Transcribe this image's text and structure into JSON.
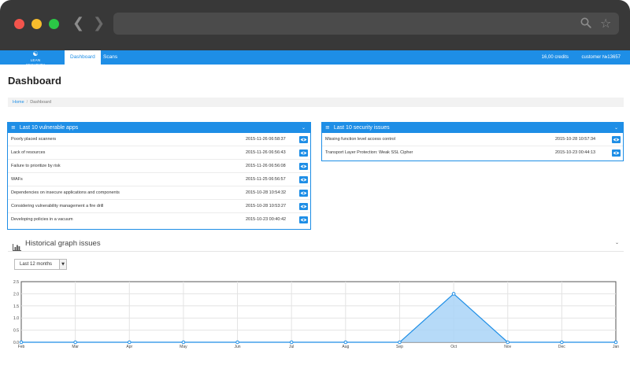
{
  "app": {
    "logo_text": "LEAN SECURITY",
    "tabs": [
      {
        "label": "Dashboard",
        "active": true
      },
      {
        "label": "Scans",
        "active": false
      }
    ],
    "credits": "16,00 credits",
    "customer": "customer №13657"
  },
  "page": {
    "title": "Dashboard",
    "breadcrumb": {
      "home": "Home",
      "separator": "/",
      "current": "Dashboard"
    }
  },
  "vulnerable_apps": {
    "title": "Last 10 vulnerable apps",
    "rows": [
      {
        "name": "Poorly placed scanners",
        "date": "2015-11-26 06:58:37"
      },
      {
        "name": "Lack of resources",
        "date": "2015-11-26 06:56:43"
      },
      {
        "name": "Failure to prioritize by risk",
        "date": "2015-11-26 06:56:08"
      },
      {
        "name": "WAFs",
        "date": "2015-11-25 06:56:57"
      },
      {
        "name": "Dependencies on insecure applications and components",
        "date": "2015-10-28 10:54:32"
      },
      {
        "name": "Considering vulnerability management a fire drill",
        "date": "2015-10-28 10:53:27"
      },
      {
        "name": "Developing policies in a vacuum",
        "date": "2015-10-23 00:40:42"
      }
    ]
  },
  "security_issues": {
    "title": "Last 10 security issues",
    "rows": [
      {
        "name": "Missing function level access control",
        "date": "2015-10-28 10:57:34"
      },
      {
        "name": "Transport Layer Protection: Weak SSL Cipher",
        "date": "2015-10-23 00:44:13"
      }
    ]
  },
  "graph": {
    "title": "Historical graph issues",
    "period_selected": "Last 12 months"
  },
  "colors": {
    "brand": "#1e8ee6",
    "area_fill": "#a9d3f7",
    "area_line": "#1e8ee6"
  },
  "chart_data": {
    "type": "area",
    "x": [
      "Feb",
      "Mar",
      "Apr",
      "May",
      "Jun",
      "Jul",
      "Aug",
      "Sep",
      "Oct",
      "Nov",
      "Dec",
      "Jan"
    ],
    "values": [
      0,
      0,
      0,
      0,
      0,
      0,
      0,
      0,
      2,
      0,
      0,
      0
    ],
    "ylim": [
      0,
      2.5
    ],
    "yticks": [
      "0.0",
      "0.5",
      "1.0",
      "1.5",
      "2.0",
      "2.5"
    ],
    "grid": true
  }
}
